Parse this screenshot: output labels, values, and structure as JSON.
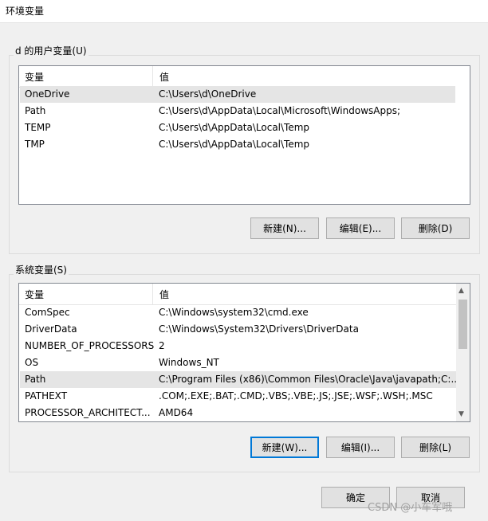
{
  "window": {
    "title": "环境变量"
  },
  "user_vars": {
    "group_label": "d 的用户变量(U)",
    "col_name": "变量",
    "col_value": "值",
    "rows": [
      {
        "name": "OneDrive",
        "value": "C:\\Users\\d\\OneDrive"
      },
      {
        "name": "Path",
        "value": "C:\\Users\\d\\AppData\\Local\\Microsoft\\WindowsApps;"
      },
      {
        "name": "TEMP",
        "value": "C:\\Users\\d\\AppData\\Local\\Temp"
      },
      {
        "name": "TMP",
        "value": "C:\\Users\\d\\AppData\\Local\\Temp"
      }
    ],
    "new_label": "新建(N)...",
    "edit_label": "编辑(E)...",
    "delete_label": "删除(D)"
  },
  "system_vars": {
    "group_label": "系统变量(S)",
    "col_name": "变量",
    "col_value": "值",
    "rows": [
      {
        "name": "ComSpec",
        "value": "C:\\Windows\\system32\\cmd.exe"
      },
      {
        "name": "DriverData",
        "value": "C:\\Windows\\System32\\Drivers\\DriverData"
      },
      {
        "name": "NUMBER_OF_PROCESSORS",
        "value": "2"
      },
      {
        "name": "OS",
        "value": "Windows_NT"
      },
      {
        "name": "Path",
        "value": "C:\\Program Files (x86)\\Common Files\\Oracle\\Java\\javapath;C:..."
      },
      {
        "name": "PATHEXT",
        "value": ".COM;.EXE;.BAT;.CMD;.VBS;.VBE;.JS;.JSE;.WSF;.WSH;.MSC"
      },
      {
        "name": "PROCESSOR_ARCHITECT...",
        "value": "AMD64"
      }
    ],
    "new_label": "新建(W)...",
    "edit_label": "编辑(I)...",
    "delete_label": "删除(L)"
  },
  "footer": {
    "ok_label": "确定",
    "cancel_label": "取消"
  },
  "watermark": "CSDN @小车军哦"
}
